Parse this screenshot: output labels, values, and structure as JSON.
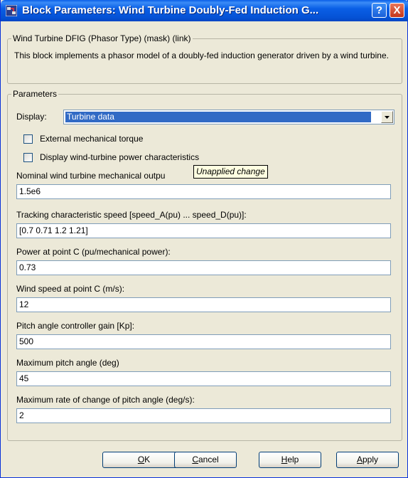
{
  "window": {
    "title": "Block Parameters: Wind Turbine Doubly-Fed Induction G...",
    "help_button": "?",
    "close_button": "X"
  },
  "description_group": {
    "legend": "Wind Turbine DFIG (Phasor Type) (mask) (link)",
    "text": "This block implements a phasor model of a doubly-fed induction generator driven by a wind turbine."
  },
  "parameters_group": {
    "legend": "Parameters",
    "display_label": "Display:",
    "display_value": "Turbine data",
    "checkboxes": [
      {
        "label": "External mechanical torque",
        "checked": false
      },
      {
        "label": "Display wind-turbine power characteristics",
        "checked": false
      }
    ],
    "tooltip": "Unapplied change",
    "fields": [
      {
        "label": "Nominal wind turbine mechanical outpu",
        "value": "1.5e6"
      },
      {
        "label": "Tracking characteristic speed [speed_A(pu) ... speed_D(pu)]:",
        "value": "[0.7 0.71 1.2 1.21]"
      },
      {
        "label": "Power at point C (pu/mechanical power):",
        "value": "0.73"
      },
      {
        "label": "Wind speed at point C (m/s):",
        "value": "12"
      },
      {
        "label": "Pitch angle controller gain [Kp]:",
        "value": "500"
      },
      {
        "label": "Maximum pitch angle (deg)",
        "value": "45"
      },
      {
        "label": "Maximum rate of change of pitch angle (deg/s):",
        "value": "2"
      }
    ]
  },
  "buttons": {
    "ok": {
      "mnemonic": "O",
      "rest": "K"
    },
    "cancel": {
      "mnemonic": "C",
      "rest": "ancel"
    },
    "help": {
      "mnemonic": "H",
      "rest": "elp"
    },
    "apply": {
      "mnemonic": "A",
      "rest": "pply"
    }
  },
  "colors": {
    "titlebar": "#0a5fe6",
    "selection": "#316ac5",
    "dialog_background": "#ece9d8",
    "tooltip_background": "#ffffe1"
  }
}
